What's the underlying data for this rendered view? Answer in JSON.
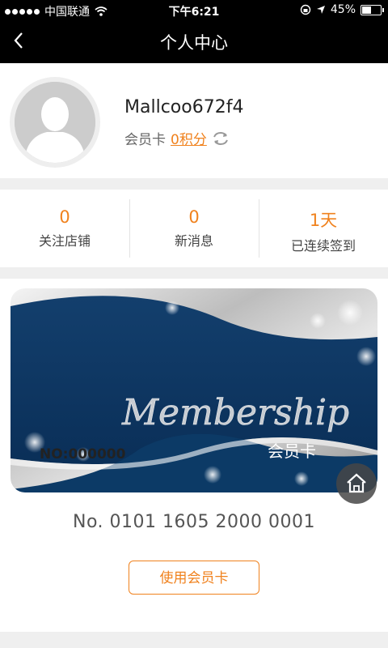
{
  "status_bar": {
    "carrier": "中国联通",
    "time": "下午6:21",
    "battery": "45%",
    "battery_level": 0.45
  },
  "nav": {
    "title": "个人中心"
  },
  "profile": {
    "username": "Mallcoo672f4",
    "card_label": "会员卡",
    "points": "0积分"
  },
  "stats": [
    {
      "value": "0",
      "label": "关注店铺"
    },
    {
      "value": "0",
      "label": "新消息"
    },
    {
      "value": "1天",
      "label": "已连续签到"
    }
  ],
  "membership_card": {
    "script_title": "Membership",
    "card_label": "会员卡",
    "card_code": "NO:000000"
  },
  "card_number": "No. 0101 1605 2000 0001",
  "use_button": "使用会员卡",
  "colors": {
    "accent": "#f0821e",
    "card_navy": "#0d3864"
  }
}
